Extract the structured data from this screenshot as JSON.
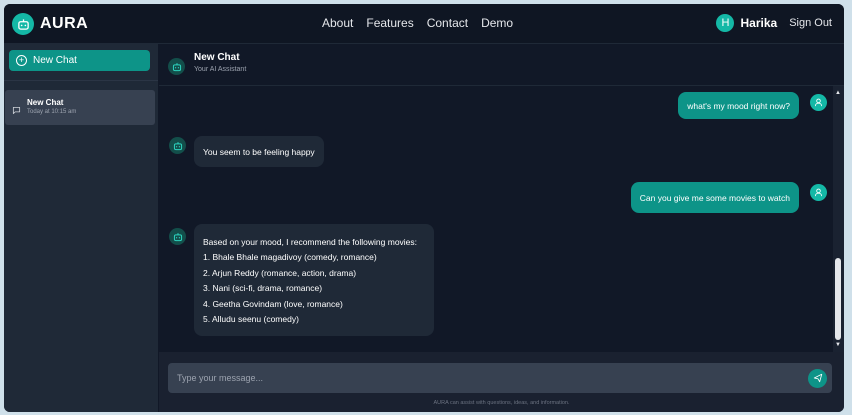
{
  "brand": {
    "name": "AURA"
  },
  "nav": {
    "items": [
      "About",
      "Features",
      "Contact",
      "Demo"
    ]
  },
  "user": {
    "initial": "H",
    "name": "Harika",
    "signout_label": "Sign Out"
  },
  "sidebar": {
    "new_chat_label": "New Chat",
    "chats": [
      {
        "title": "New Chat",
        "time": "Today at 10:15 am"
      }
    ]
  },
  "chat_header": {
    "title": "New Chat",
    "subtitle": "Your AI Assistant"
  },
  "messages": [
    {
      "role": "user",
      "text": "what's my mood right now?"
    },
    {
      "role": "bot",
      "text": "You seem to be feeling happy"
    },
    {
      "role": "user",
      "text": "Can you give me some movies to watch"
    },
    {
      "role": "bot",
      "lines": [
        "Based on your mood, I recommend the following movies:",
        "1. Bhale Bhale magadivoy (comedy, romance)",
        "2. Arjun Reddy (romance, action, drama)",
        "3. Nani (sci-fi, drama, romance)",
        "4. Geetha Govindam (love, romance)",
        "5. Alludu seenu (comedy)"
      ]
    }
  ],
  "composer": {
    "placeholder": "Type your message...",
    "footnote": "AURA can assist with questions, ideas, and information."
  },
  "colors": {
    "accent": "#14b8a6",
    "accent_dark": "#0d9488",
    "background": "#111827",
    "panel": "#1f2937"
  },
  "icons": {
    "brand": "robot-icon",
    "bot": "robot-icon",
    "user": "person-icon",
    "new_chat": "plus-circle-icon",
    "chat_item": "message-square-icon",
    "send": "send-icon"
  }
}
